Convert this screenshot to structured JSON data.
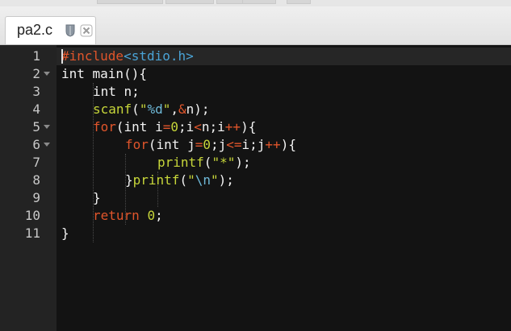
{
  "tab": {
    "title": "pa2.c",
    "pin_icon": "pin-icon",
    "close_icon": "close-icon"
  },
  "editor": {
    "lines": [
      {
        "n": "1"
      },
      {
        "n": "2"
      },
      {
        "n": "3"
      },
      {
        "n": "4"
      },
      {
        "n": "5"
      },
      {
        "n": "6"
      },
      {
        "n": "7"
      },
      {
        "n": "8"
      },
      {
        "n": "9"
      },
      {
        "n": "10"
      },
      {
        "n": "11"
      }
    ],
    "code": {
      "l1": {
        "directive": "#include",
        "header": "<stdio.h>"
      },
      "l2": {
        "text": "int main(){"
      },
      "l3": {
        "text": "int n;"
      },
      "l4": {
        "fn": "scanf",
        "open": "(",
        "str1": "\"",
        "fmt": "%d",
        "str2": "\"",
        "rest": ",",
        "amp": "&",
        "rest2": "n);"
      },
      "l5": {
        "kw": "for",
        "a": "(int i",
        "op1": "=",
        "n0": "0",
        "b": ";i",
        "op2": "<",
        "c": "n;i",
        "op3": "++",
        "d": "){"
      },
      "l6": {
        "kw": "for",
        "a": "(int j",
        "op1": "=",
        "n0": "0",
        "b": ";j",
        "op2": "<=",
        "c": "i;j",
        "op3": "++",
        "d": "){"
      },
      "l7": {
        "fn": "printf",
        "open": "(",
        "str": "\"*\"",
        "close": ");"
      },
      "l8": {
        "brace": "}",
        "fn": "printf",
        "open": "(",
        "q1": "\"",
        "esc": "\\n",
        "q2": "\"",
        "close": ");"
      },
      "l9": {
        "text": "}"
      },
      "l10": {
        "kw": "return",
        "num": "0",
        "semi": ";"
      },
      "l11": {
        "text": "}"
      }
    }
  },
  "colors": {
    "background": "#131313",
    "gutter": "#232323",
    "keyword": "#e0552b",
    "string": "#c7d63a",
    "header": "#4aa3d6",
    "escape": "#6fb9d8"
  }
}
